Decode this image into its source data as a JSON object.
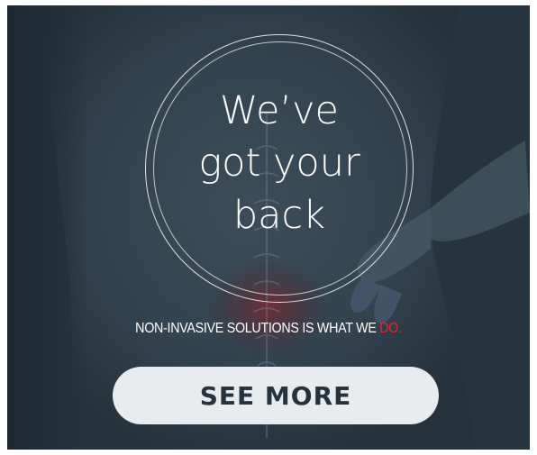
{
  "ad": {
    "headline_lines": [
      "We’ve",
      "got your",
      "back"
    ],
    "tagline_text": "NON-INVASIVE SOLUTIONS IS WHAT WE ",
    "tagline_accent": "DO.",
    "cta_label": "SEE MORE"
  },
  "colors": {
    "background": "#2b3a46",
    "accent": "#e8232f",
    "button": "#e9ecef",
    "button_text": "#26323c"
  },
  "image": {
    "subject": "back-pain-photo"
  }
}
